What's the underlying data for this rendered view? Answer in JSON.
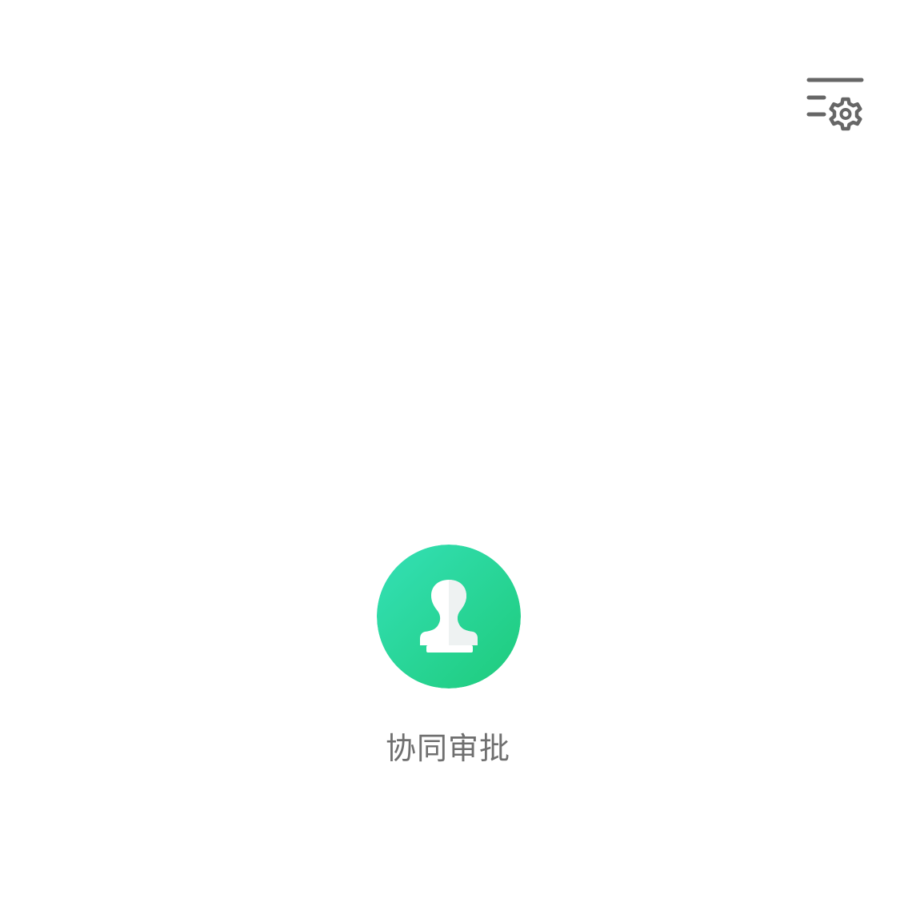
{
  "toolbar": {
    "settings_icon": "list-settings-icon"
  },
  "app": {
    "label": "协同审批",
    "icon": "stamp-icon",
    "colors": {
      "gradient_start": "#34e0b6",
      "gradient_end": "#1ecb7b",
      "glyph": "#ffffff"
    }
  },
  "colors": {
    "icon_gray": "#666666",
    "label_gray": "#6f6f6f",
    "background": "#ffffff"
  }
}
